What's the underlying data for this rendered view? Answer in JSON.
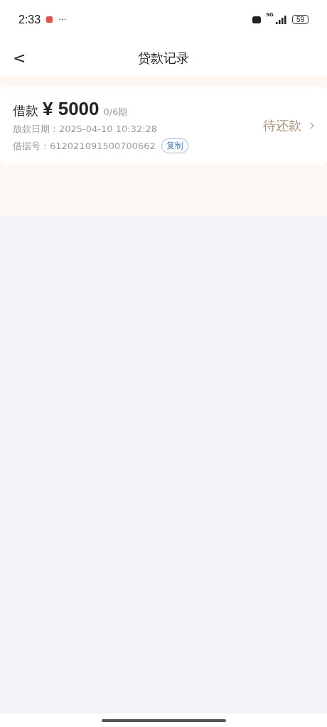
{
  "status_bar": {
    "time": "2:33",
    "more": "···",
    "network": "5G",
    "battery": "59"
  },
  "nav": {
    "back": "<",
    "title": "贷款记录"
  },
  "records": [
    {
      "label": "借款",
      "currency": "¥",
      "amount": "5000",
      "periods": "0/6期",
      "date_label": "放款日期：",
      "date": "2025-04-10 10:32:28",
      "id_label": "借据号：",
      "id": "612021091500700662",
      "copy": "复制",
      "status": "待还款"
    }
  ]
}
